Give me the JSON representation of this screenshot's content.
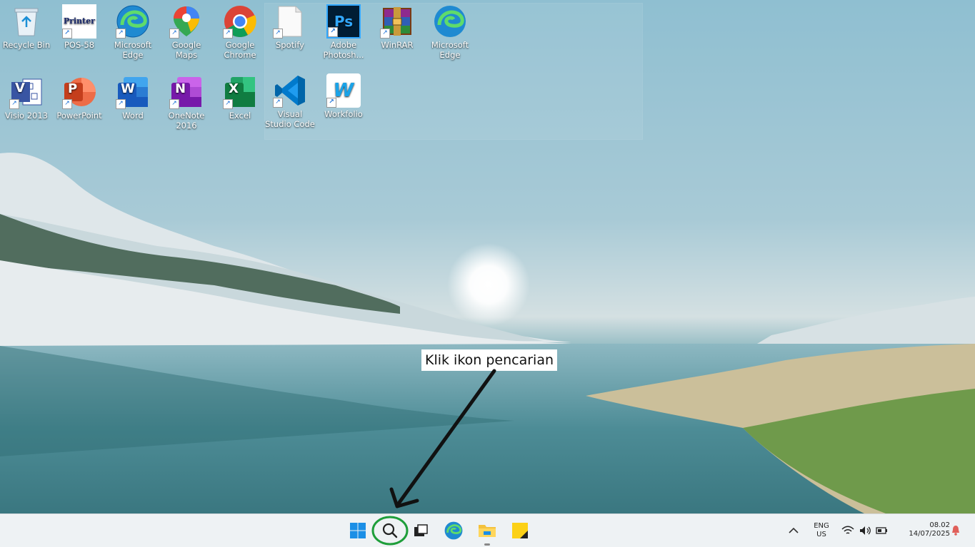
{
  "desktop_icons": [
    {
      "label": "Recycle Bin",
      "icon": "recycle-bin-icon",
      "shortcut": false
    },
    {
      "label": "POS-58",
      "icon": "printer-icon",
      "shortcut": true,
      "glyph_text": "Printer"
    },
    {
      "label": "Microsoft Edge",
      "icon": "edge-icon",
      "shortcut": true
    },
    {
      "label": "Google Maps",
      "icon": "google-maps-icon",
      "shortcut": true
    },
    {
      "label": "Google Chrome",
      "icon": "chrome-icon",
      "shortcut": true
    },
    {
      "label": "Spotify",
      "icon": "spotify-file-icon",
      "shortcut": true
    },
    {
      "label": "Adobe Photosh...",
      "icon": "photoshop-icon",
      "shortcut": true,
      "glyph_text": "Ps"
    },
    {
      "label": "WinRAR",
      "icon": "winrar-icon",
      "shortcut": true
    },
    {
      "label": "Microsoft Edge",
      "icon": "edge-icon",
      "shortcut": false
    },
    {
      "label": "Visio 2013",
      "icon": "visio-icon",
      "shortcut": true,
      "glyph_text": "V"
    },
    {
      "label": "PowerPoint",
      "icon": "powerpoint-icon",
      "shortcut": true,
      "glyph_text": "P"
    },
    {
      "label": "Word",
      "icon": "word-icon",
      "shortcut": true,
      "glyph_text": "W"
    },
    {
      "label": "OneNote 2016",
      "icon": "onenote-icon",
      "shortcut": true,
      "glyph_text": "N"
    },
    {
      "label": "Excel",
      "icon": "excel-icon",
      "shortcut": true,
      "glyph_text": "X"
    },
    {
      "label": "Visual Studio Code",
      "icon": "vscode-icon",
      "shortcut": true
    },
    {
      "label": "Workfolio",
      "icon": "workfolio-icon",
      "shortcut": true,
      "glyph_text": "W"
    }
  ],
  "annotation": {
    "callout_text": "Klik ikon pencarian"
  },
  "taskbar": {
    "pinned": [
      "windows-start-icon",
      "search-icon",
      "task-view-icon",
      "edge-icon",
      "file-explorer-icon",
      "sticky-notes-icon"
    ],
    "tray": {
      "lang_top": "ENG",
      "lang_bottom": "US",
      "time": "08.02",
      "date": "14/07/2025"
    }
  },
  "colors": {
    "annotation_circle": "#1e9e3a",
    "arrow": "#111111"
  }
}
